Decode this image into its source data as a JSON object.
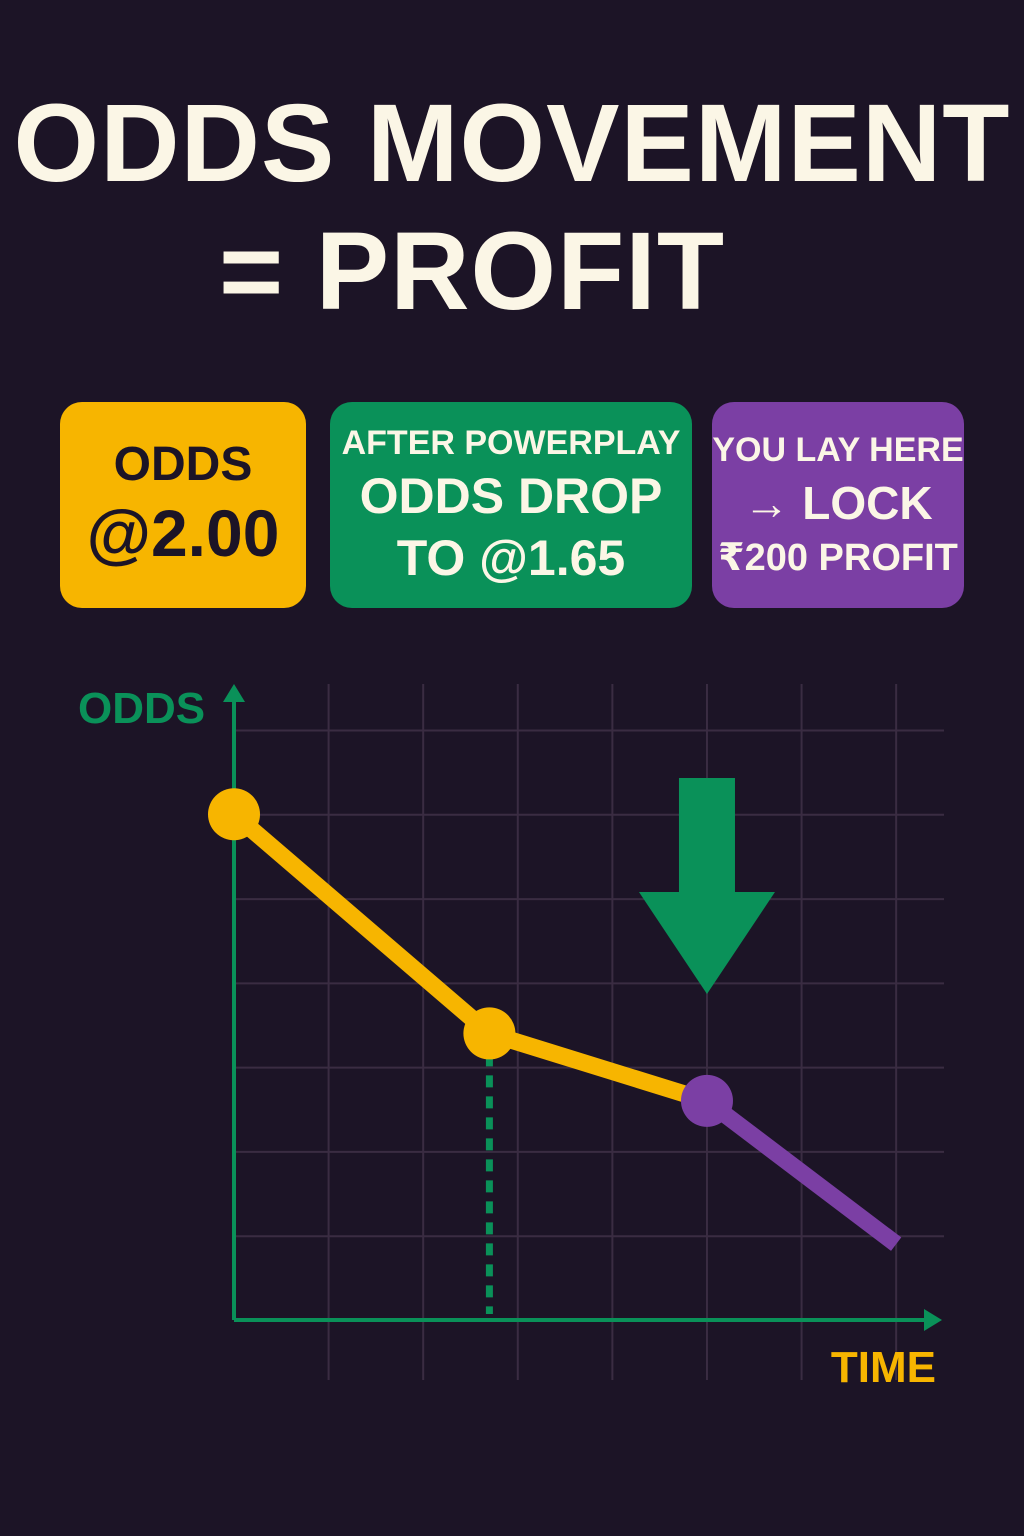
{
  "title": {
    "line1": "ODDS MOVEMENT",
    "line2": "= PROFIT"
  },
  "cards": {
    "odds": {
      "line1": "ODDS",
      "line2": "@2.00",
      "color": "#f7b500"
    },
    "drop": {
      "line1": "AFTER POWERPLAY",
      "line2": "ODDS DROP",
      "line3": "TO @1.65",
      "color": "#0a9159"
    },
    "lay": {
      "line1": "YOU LAY HERE",
      "line2": "→ LOCK",
      "line3": "₹200 PROFIT",
      "color": "#7b3fa4"
    }
  },
  "chart_data": {
    "type": "line",
    "xlabel": "TIME",
    "ylabel": "ODDS",
    "grid": true,
    "axis_color": "#0a9159",
    "series": [
      {
        "color": "#f7b500",
        "x": [
          0,
          2.7,
          5
        ],
        "y": [
          6,
          3.4,
          2.6
        ]
      },
      {
        "color": "#7b3fa4",
        "x": [
          5,
          7
        ],
        "y": [
          2.6,
          0.9
        ]
      }
    ],
    "xlim": [
      0,
      7.4
    ],
    "ylim": [
      0,
      7
    ],
    "markers": [
      {
        "x": 0,
        "y": 6,
        "color": "#f7b500"
      },
      {
        "x": 2.7,
        "y": 3.4,
        "color": "#f7b500"
      },
      {
        "x": 5,
        "y": 2.6,
        "color": "#7b3fa4"
      }
    ],
    "annotations": [
      {
        "kind": "dashed-drop-line",
        "x": 2.7,
        "y": 3.4,
        "color": "#0a9159"
      },
      {
        "kind": "down-arrow",
        "x": 5,
        "color": "#0a9159"
      }
    ]
  }
}
